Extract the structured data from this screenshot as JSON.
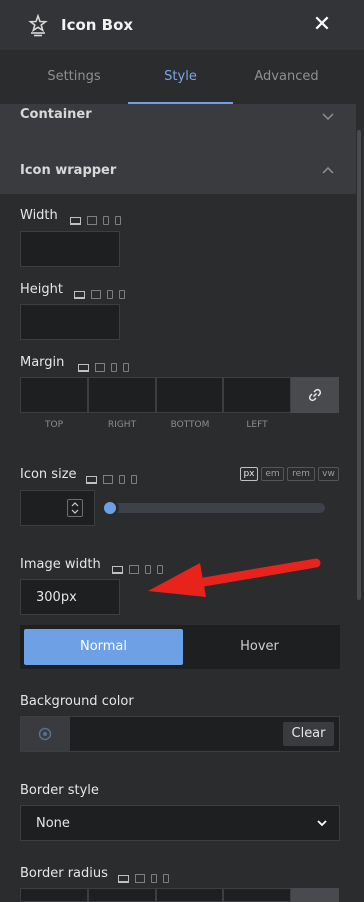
{
  "header": {
    "title": "Icon Box",
    "logo_icon": "star-badge-icon",
    "close_icon": "close-icon"
  },
  "tabs": [
    {
      "label": "Settings",
      "active": false
    },
    {
      "label": "Style",
      "active": true
    },
    {
      "label": "Advanced",
      "active": false
    }
  ],
  "sections": {
    "container": {
      "label": "Container",
      "expanded": false
    },
    "icon_wrapper": {
      "label": "Icon wrapper",
      "expanded": true
    }
  },
  "fields": {
    "width": {
      "label": "Width",
      "value": ""
    },
    "height": {
      "label": "Height",
      "value": ""
    },
    "margin": {
      "label": "Margin",
      "captions": [
        "TOP",
        "RIGHT",
        "BOTTOM",
        "LEFT"
      ],
      "link_icon": "link-icon"
    },
    "icon_size": {
      "label": "Icon size",
      "units": [
        "px",
        "em",
        "rem",
        "vw"
      ],
      "selected_unit": "px",
      "value": "",
      "slider_level": 0
    },
    "image_width": {
      "label": "Image width",
      "value": "300px"
    },
    "state_toggle": {
      "normal": "Normal",
      "hover": "Hover",
      "active": "Normal"
    },
    "background_color": {
      "label": "Background color",
      "clear": "Clear"
    },
    "border_style": {
      "label": "Border style",
      "value": "None"
    },
    "border_radius": {
      "label": "Border radius"
    }
  },
  "colors": {
    "accent": "#6ea0e6",
    "annotation_arrow": "#e8231c"
  }
}
